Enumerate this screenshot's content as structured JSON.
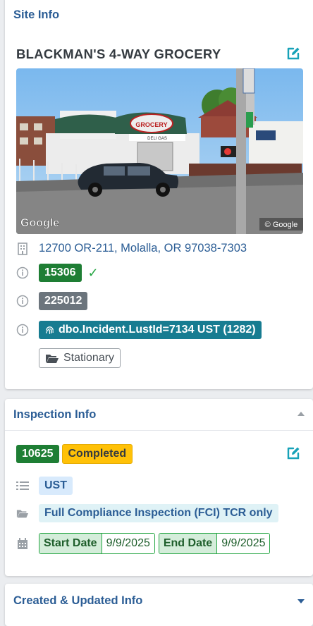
{
  "site_info": {
    "title": "Site Info",
    "site_name": "BLACKMAN'S 4-WAY GROCERY",
    "address": "12700 OR-211, Molalla, OR 97038-7303",
    "site_id": "15306",
    "secondary_id": "225012",
    "lust_link": "dbo.Incident.LustId=7134 UST (1282)",
    "facility_type": "Stationary",
    "photo": {
      "sign_text": "GROCERY",
      "sign_subtext": "DELI GAS",
      "attribution": "Google",
      "copyright": "© Google"
    }
  },
  "inspection_info": {
    "title": "Inspection Info",
    "inspection_id": "10625",
    "status": "Completed",
    "program": "UST",
    "inspection_type": "Full Compliance Inspection (FCI) TCR only",
    "start_date_label": "Start Date",
    "start_date": "9/9/2025",
    "end_date_label": "End Date",
    "end_date": "9/9/2025"
  },
  "created_updated": {
    "title": "Created & Updated Info"
  },
  "colors": {
    "primary": "#2b5d95",
    "success": "#1e7e34",
    "warning": "#ffc107",
    "teal": "#177c91"
  }
}
